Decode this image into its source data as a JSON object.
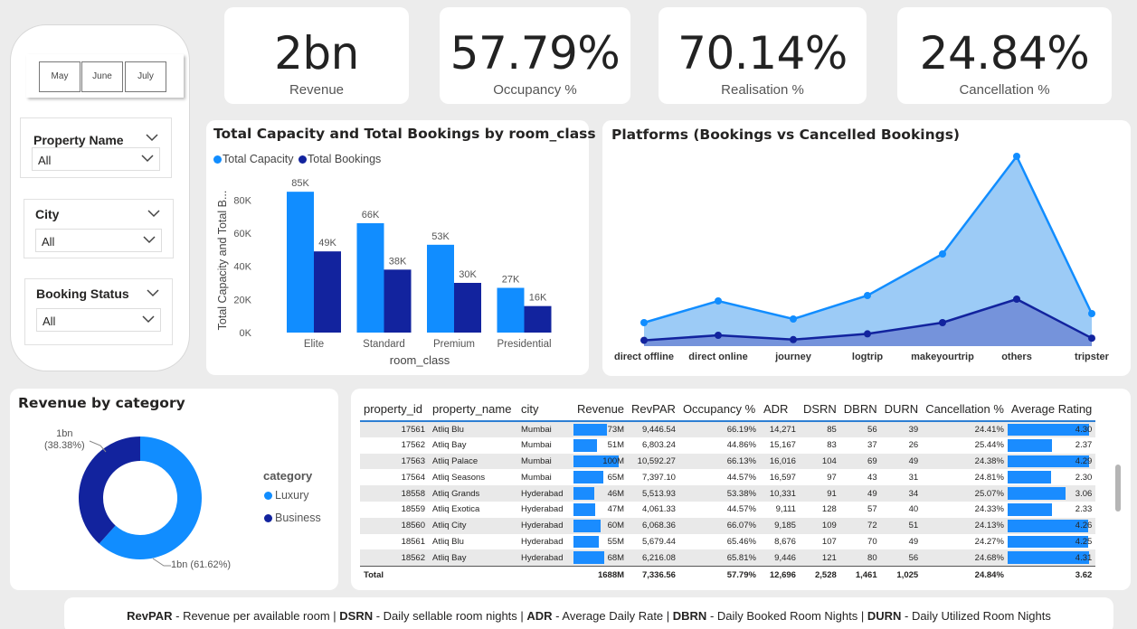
{
  "kpis": [
    {
      "value": "2bn",
      "label": "Revenue"
    },
    {
      "value": "57.79%",
      "label": "Occupancy %"
    },
    {
      "value": "70.14%",
      "label": "Realisation %"
    },
    {
      "value": "24.84%",
      "label": "Cancellation %"
    }
  ],
  "months": [
    "May",
    "June",
    "July"
  ],
  "slicers": [
    {
      "title": "Property Name",
      "value": "All"
    },
    {
      "title": "City",
      "value": "All"
    },
    {
      "title": "Booking Status",
      "value": "All"
    }
  ],
  "colors": {
    "light": "#118dff",
    "dark": "#12239e",
    "area_light": "#9ccbf6",
    "area_dark": "#6e8ad6"
  },
  "chart_data": [
    {
      "type": "bar",
      "title": "Total Capacity and Total Bookings by room_class",
      "xlabel": "room_class",
      "ylabel": "Total Capacity and Total B...",
      "categories": [
        "Elite",
        "Standard",
        "Premium",
        "Presidential"
      ],
      "series": [
        {
          "name": "Total Capacity",
          "values": [
            85000,
            66000,
            53000,
            27000
          ],
          "labels": [
            "85K",
            "66K",
            "53K",
            "27K"
          ]
        },
        {
          "name": "Total Bookings",
          "values": [
            49000,
            38000,
            30000,
            16000
          ],
          "labels": [
            "49K",
            "38K",
            "30K",
            "16K"
          ]
        }
      ],
      "yticks": [
        "0K",
        "20K",
        "40K",
        "60K",
        "80K"
      ],
      "ylim": [
        0,
        90000
      ],
      "legend": "top-left"
    },
    {
      "type": "area",
      "title": "Platforms (Bookings vs Cancelled Bookings)",
      "categories": [
        "direct offline",
        "direct online",
        "journey",
        "logtrip",
        "makeyourtrip",
        "others",
        "tripster"
      ],
      "series": [
        {
          "values": [
            6500,
            12500,
            7500,
            14000,
            25500,
            52500,
            9000
          ]
        },
        {
          "values": [
            1600,
            3000,
            1800,
            3400,
            6500,
            13000,
            2200
          ]
        }
      ],
      "ylim": [
        0,
        55000
      ]
    },
    {
      "type": "pie",
      "title": "Revenue by category",
      "legend_title": "category",
      "slices": [
        {
          "name": "Luxury",
          "value": 61.62,
          "label": "1bn (61.62%)"
        },
        {
          "name": "Business",
          "value": 38.38,
          "label": "1bn\n(38.38%)"
        }
      ],
      "legend": "right"
    }
  ],
  "table": {
    "headers": [
      "property_id",
      "property_name",
      "city",
      "Revenue",
      "RevPAR",
      "Occupancy %",
      "ADR",
      "DSRN",
      "DBRN",
      "DURN",
      "Cancellation %",
      "Average Rating"
    ],
    "rows": [
      [
        "17561",
        "Atliq Blu",
        "Mumbai",
        "73M",
        "9,446.54",
        "66.19%",
        "14,271",
        "85",
        "56",
        "39",
        "24.41%",
        "4.30"
      ],
      [
        "17562",
        "Atliq Bay",
        "Mumbai",
        "51M",
        "6,803.24",
        "44.86%",
        "15,167",
        "83",
        "37",
        "26",
        "25.44%",
        "2.37"
      ],
      [
        "17563",
        "Atliq Palace",
        "Mumbai",
        "100M",
        "10,592.27",
        "66.13%",
        "16,016",
        "104",
        "69",
        "49",
        "24.38%",
        "4.29"
      ],
      [
        "17564",
        "Atliq Seasons",
        "Mumbai",
        "65M",
        "7,397.10",
        "44.57%",
        "16,597",
        "97",
        "43",
        "31",
        "24.81%",
        "2.30"
      ],
      [
        "18558",
        "Atliq Grands",
        "Hyderabad",
        "46M",
        "5,513.93",
        "53.38%",
        "10,331",
        "91",
        "49",
        "34",
        "25.07%",
        "3.06"
      ],
      [
        "18559",
        "Atliq Exotica",
        "Hyderabad",
        "47M",
        "4,061.33",
        "44.57%",
        "9,111",
        "128",
        "57",
        "40",
        "24.33%",
        "2.33"
      ],
      [
        "18560",
        "Atliq City",
        "Hyderabad",
        "60M",
        "6,068.36",
        "66.07%",
        "9,185",
        "109",
        "72",
        "51",
        "24.13%",
        "4.26"
      ],
      [
        "18561",
        "Atliq Blu",
        "Hyderabad",
        "55M",
        "5,679.44",
        "65.46%",
        "8,676",
        "107",
        "70",
        "49",
        "24.27%",
        "4.25"
      ],
      [
        "18562",
        "Atliq Bay",
        "Hyderabad",
        "68M",
        "6,216.08",
        "65.81%",
        "9,446",
        "121",
        "80",
        "56",
        "24.68%",
        "4.31"
      ]
    ],
    "revenue_values": [
      73,
      51,
      100,
      65,
      46,
      47,
      60,
      55,
      68
    ],
    "rating_values": [
      4.3,
      2.37,
      4.29,
      2.3,
      3.06,
      2.33,
      4.26,
      4.25,
      4.31
    ],
    "total": [
      "Total",
      "",
      "",
      "1688M",
      "7,336.56",
      "57.79%",
      "12,696",
      "2,528",
      "1,461",
      "1,025",
      "24.84%",
      "3.62"
    ]
  },
  "footer": [
    {
      "bold": "RevPAR",
      "text": " - Revenue per available room | "
    },
    {
      "bold": "DSRN",
      "text": " - Daily sellable room nights | "
    },
    {
      "bold": "ADR",
      "text": " - Average Daily Rate | "
    },
    {
      "bold": "DBRN",
      "text": " - Daily Booked Room Nights | "
    },
    {
      "bold": "DURN",
      "text": " - Daily Utilized Room Nights"
    }
  ]
}
